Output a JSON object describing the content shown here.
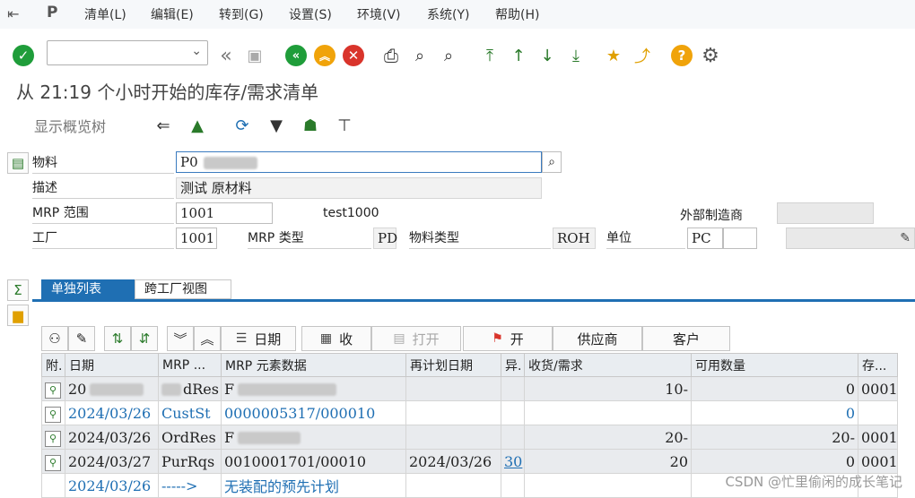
{
  "menu": {
    "items": [
      "清单(L)",
      "编辑(E)",
      "转到(G)",
      "设置(S)",
      "环境(V)",
      "系统(Y)",
      "帮助(H)"
    ]
  },
  "toolbar": {
    "command_field_value": ""
  },
  "title": "从 21:19 个小时开始的库存/需求清单",
  "appbar": {
    "overview_tree_label": "显示概览树"
  },
  "header": {
    "material_label": "物料",
    "material_value": "P0",
    "description_label": "描述",
    "description_value": "测试    原材料",
    "mrp_area_label": "MRP 范围",
    "mrp_area_value": "1001",
    "mrp_area_text": "test1000",
    "ext_manufacturer_label": "外部制造商",
    "plant_label": "工厂",
    "plant_value": "1001",
    "mrp_type_label": "MRP 类型",
    "mrp_type_value": "PD",
    "material_type_label": "物料类型",
    "material_type_value": "ROH",
    "unit_label": "单位",
    "unit_value": "PC"
  },
  "tabs": {
    "single_list": "单独列表",
    "cross_plant": "跨工厂视图"
  },
  "side": {
    "sum_icon": "Σ"
  },
  "grid_toolbar": {
    "date_label": "日期",
    "receipt_label": "收",
    "open_label": "打开",
    "open2_label": "开",
    "vendor_label": "供应商",
    "customer_label": "客户"
  },
  "table": {
    "columns": [
      "附.",
      "日期",
      "MRP ...",
      "MRP 元素数据",
      "再计划日期",
      "异.",
      "收货/需求",
      "可用数量",
      "存..."
    ],
    "rows": [
      {
        "date": "20",
        "mrp": "dRes",
        "data": "F",
        "replan": "",
        "exc": "",
        "qty": "10-",
        "avail": "0",
        "stor": "0001"
      },
      {
        "date": "2024/03/26",
        "mrp": "CustSt",
        "data": "0000005317/000010",
        "replan": "",
        "exc": "",
        "qty": "",
        "avail": "0",
        "stor": ""
      },
      {
        "date": "2024/03/26",
        "mrp": "OrdRes",
        "data": "F",
        "replan": "",
        "exc": "",
        "qty": "20-",
        "avail": "20-",
        "stor": "0001"
      },
      {
        "date": "2024/03/27",
        "mrp": "PurRqs",
        "data": "0010001701/00010",
        "replan": "2024/03/26",
        "exc": "30",
        "qty": "20",
        "avail": "0",
        "stor": "0001"
      },
      {
        "date": "2024/03/26",
        "mrp": "----->",
        "data": "无装配的预先计划",
        "replan": "",
        "exc": "",
        "qty": "",
        "avail": "",
        "stor": ""
      }
    ]
  },
  "watermark": "CSDN @忙里偷闲的成长笔记",
  "colors": {
    "accent": "#1f6fb3",
    "green_ok": "#1f9d3a",
    "orange": "#f0a30a",
    "red": "#d9342b"
  }
}
